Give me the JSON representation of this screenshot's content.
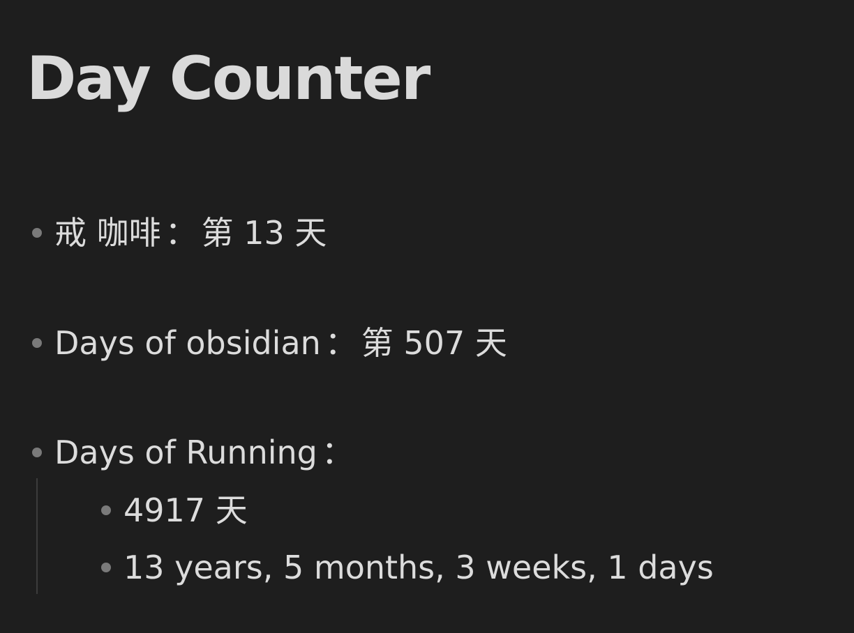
{
  "page": {
    "title": "Day Counter"
  },
  "list": {
    "coffee": {
      "label": "戒 咖啡",
      "sep": "：",
      "value": "第 13 天"
    },
    "obsidian": {
      "label": "Days of obsidian",
      "sep": "：",
      "value": "第 507 天"
    },
    "running": {
      "label": "Days of Running",
      "sep": "：",
      "children": [
        "4917 天",
        "13 years, 5 months, 3 weeks, 1 days"
      ]
    }
  },
  "colors": {
    "background": "#1e1e1e",
    "text": "#dcdcdc",
    "bullet": "#7a7a7a",
    "indent_guide": "#3c3c3c"
  },
  "icons": {
    "bullet": "bullet-dot-icon"
  }
}
